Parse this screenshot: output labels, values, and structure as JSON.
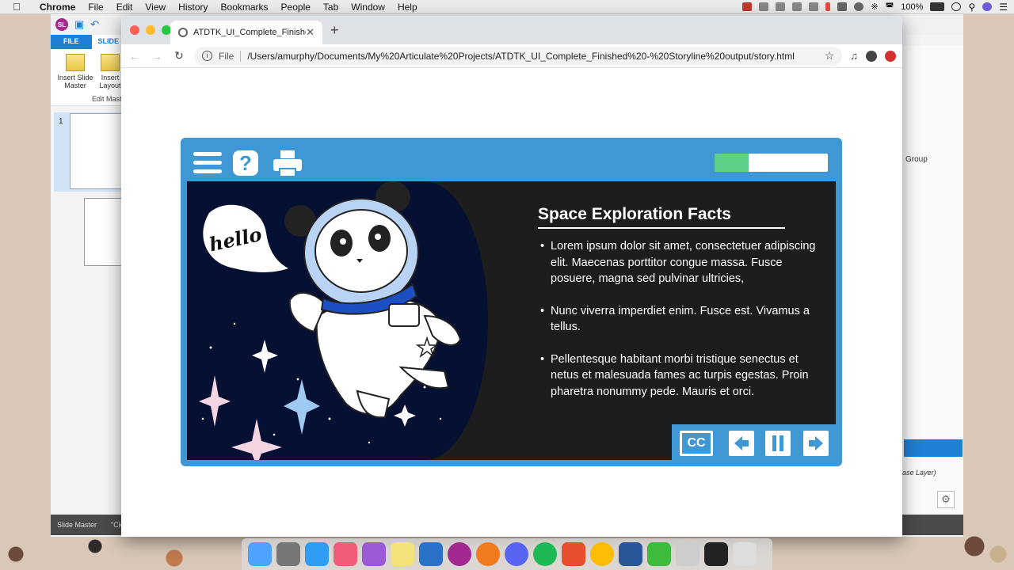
{
  "menubar": {
    "app_name": "Chrome",
    "items": [
      "File",
      "Edit",
      "View",
      "History",
      "Bookmarks",
      "People",
      "Tab",
      "Window",
      "Help"
    ],
    "battery": "100%"
  },
  "storyline": {
    "ribbon_tabs": {
      "file": "FILE",
      "slide_master": "SLIDE M"
    },
    "buttons": {
      "insert_slide_master": "Insert Slide Master",
      "insert_layout": "Insert Layout"
    },
    "group_label": "Edit Mast",
    "thumb_number": "1",
    "status_left": "Slide Master",
    "status_right": "\"Cle",
    "panel_group": "Group",
    "layer_label": "ase Layer)"
  },
  "browser": {
    "tab_title": "ATDTK_UI_Complete_Finished",
    "url_scheme": "File",
    "url": "/Users/amurphy/Documents/My%20Articulate%20Projects/ATDTK_UI_Complete_Finished%20-%20Storyline%20output/story.html"
  },
  "player": {
    "progress": 0.3,
    "help_label": "?",
    "cc_label": "CC",
    "prev_icon": "arrow-left-icon",
    "next_icon": "arrow-right-icon"
  },
  "slide": {
    "speech": "hello",
    "title": "Space Exploration Facts",
    "bullets": [
      "Lorem ipsum dolor sit amet, consectetuer adipiscing elit. Maecenas porttitor congue massa. Fusce posuere, magna sed pulvinar ultricies,",
      "Nunc viverra imperdiet enim. Fusce est. Vivamus a tellus.",
      "Pellentesque habitant morbi tristique senectus et netus et malesuada fames ac turpis egestas. Proin pharetra nonummy pede. Mauris et orci."
    ]
  },
  "colors": {
    "player_blue": "#3f97d3",
    "progress_green": "#5ccf88",
    "space_navy": "#061033"
  }
}
